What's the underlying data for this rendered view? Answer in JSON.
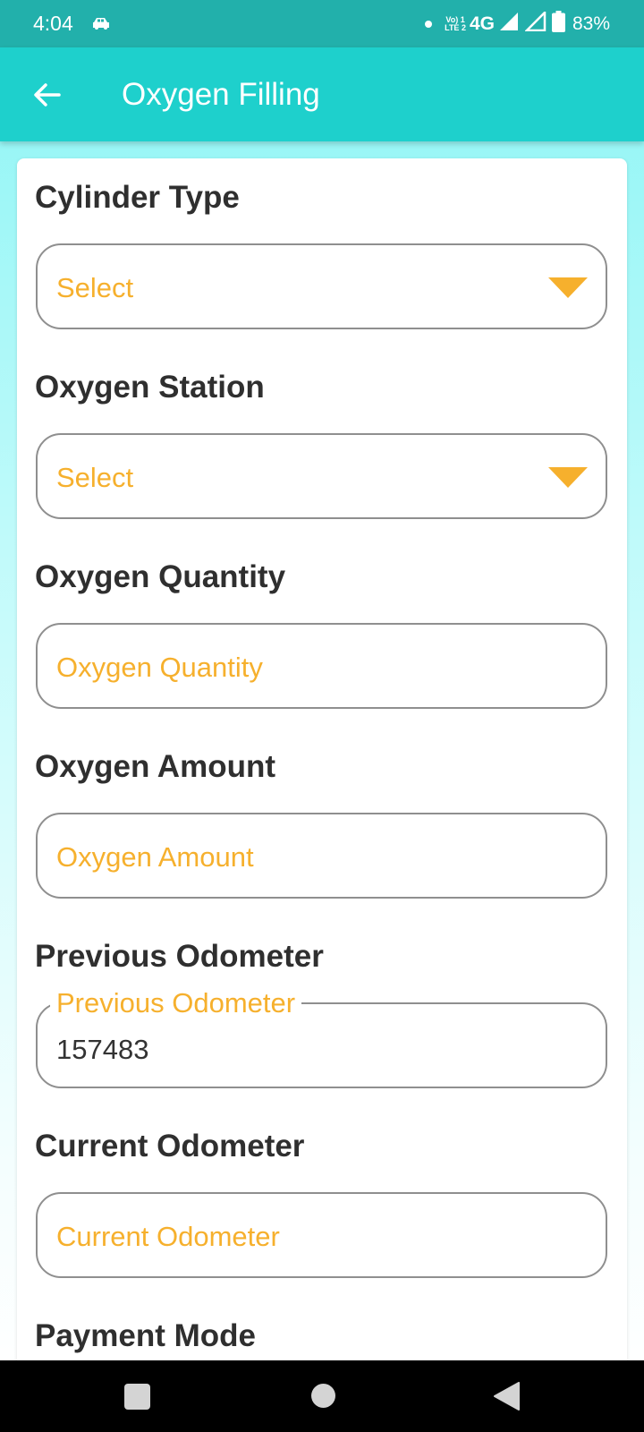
{
  "status_bar": {
    "time": "4:04",
    "network_type": "4G",
    "volte_line1": "Vo) 1",
    "volte_line2": "LTE 2",
    "battery_percent": "83%",
    "icons": [
      "car-icon",
      "notification-dot-icon",
      "volte-icon",
      "signal-icon",
      "signal-icon",
      "battery-icon"
    ]
  },
  "app_bar": {
    "title": "Oxygen Filling",
    "back_icon": "arrow-left-icon"
  },
  "form": {
    "cylinder_type": {
      "label": "Cylinder Type",
      "selected": "Select"
    },
    "oxygen_station": {
      "label": "Oxygen Station",
      "selected": "Select"
    },
    "oxygen_quantity": {
      "label": "Oxygen Quantity",
      "placeholder": "Oxygen Quantity"
    },
    "oxygen_amount": {
      "label": "Oxygen Amount",
      "placeholder": "Oxygen Amount"
    },
    "previous_odometer": {
      "label": "Previous Odometer",
      "hint": "Previous Odometer",
      "value": "157483"
    },
    "current_odometer": {
      "label": "Current Odometer",
      "placeholder": "Current Odometer"
    },
    "payment_mode": {
      "label": "Payment Mode"
    }
  },
  "nav_bar": {
    "icons": [
      "recents-icon",
      "home-icon",
      "back-icon"
    ]
  },
  "colors": {
    "status_bar": "#22b0ab",
    "app_bar": "#1ed0cc",
    "accent": "#f6b02d",
    "label_text": "#2f2f2f",
    "border": "#8f8f8f"
  }
}
